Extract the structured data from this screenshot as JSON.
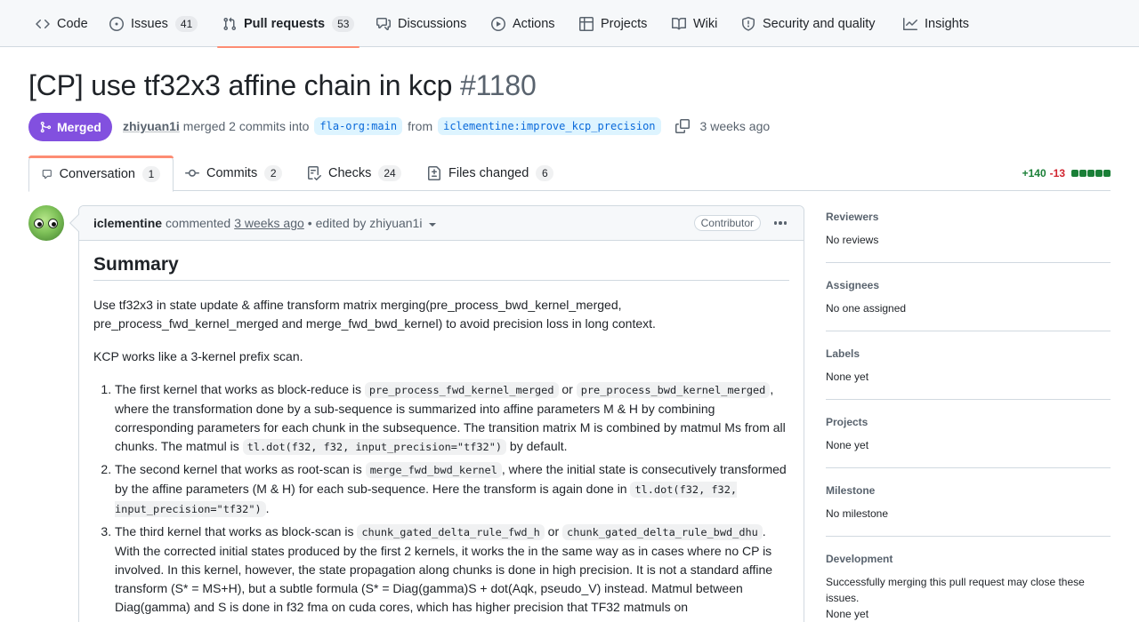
{
  "repo_nav": {
    "items": [
      {
        "label": "Code",
        "icon": "code-icon"
      },
      {
        "label": "Issues",
        "icon": "issue-icon",
        "count": "41"
      },
      {
        "label": "Pull requests",
        "icon": "pull-request-icon",
        "count": "53",
        "active": true
      },
      {
        "label": "Discussions",
        "icon": "comment-discussion-icon"
      },
      {
        "label": "Actions",
        "icon": "play-icon"
      },
      {
        "label": "Projects",
        "icon": "table-icon"
      },
      {
        "label": "Wiki",
        "icon": "book-icon"
      },
      {
        "label": "Security and quality",
        "icon": "shield-icon"
      },
      {
        "label": "Insights",
        "icon": "graph-icon"
      }
    ]
  },
  "pr": {
    "title": "[CP] use tf32x3 affine chain in kcp",
    "number": "#1180",
    "state": "Merged",
    "author": "zhiyuan1i",
    "merged_text": "merged 2 commits into",
    "base_branch": "fla-org:main",
    "from_text": "from",
    "head_branch": "iclementine:improve_kcp_precision",
    "time_ago": "3 weeks ago"
  },
  "tabs": [
    {
      "label": "Conversation",
      "count": "1",
      "icon": "comment-icon",
      "active": true
    },
    {
      "label": "Commits",
      "count": "2",
      "icon": "commit-icon"
    },
    {
      "label": "Checks",
      "count": "24",
      "icon": "checklist-icon"
    },
    {
      "label": "Files changed",
      "count": "6",
      "icon": "file-diff-icon"
    }
  ],
  "diffstat": {
    "additions": "+140",
    "deletions": "-13",
    "colors": [
      "#1a7f37",
      "#1a7f37",
      "#1a7f37",
      "#1a7f37",
      "#1a7f37",
      "#d1d9e0"
    ]
  },
  "comment": {
    "author": "iclementine",
    "action": "commented",
    "time": "3 weeks ago",
    "edited": "• edited by zhiyuan1i",
    "role": "Contributor",
    "heading": "Summary",
    "p1": "Use tf32x3 in state update & affine transform matrix merging(pre_process_bwd_kernel_merged, pre_process_fwd_kernel_merged and merge_fwd_bwd_kernel) to avoid precision loss in long context.",
    "p2": "KCP works like a 3-kernel prefix scan.",
    "li1": {
      "a": "The first kernel that works as block-reduce is ",
      "code1": "pre_process_fwd_kernel_merged",
      "b": " or ",
      "code2": "pre_process_bwd_kernel_merged",
      "c": ", where the transformation done by a sub-sequence is summarized into affine parameters M & H by combining corresponding parameters for each chunk in the subsequence. The transition matrix M is combined by matmul Ms from all chunks. The matmul is ",
      "code3": "tl.dot(f32, f32, input_precision=\"tf32\")",
      "d": " by default."
    },
    "li2": {
      "a": "The second kernel that works as root-scan is ",
      "code1": "merge_fwd_bwd_kernel",
      "b": ", where the initial state is consecutively transformed by the affine parameters (M & H) for each sub-sequence. Here the transform is again done in ",
      "code2": "tl.dot(f32, f32, input_precision=\"tf32\")",
      "c": "."
    },
    "li3": {
      "a": "The third kernel that works as block-scan is ",
      "code1": "chunk_gated_delta_rule_fwd_h",
      "b": " or ",
      "code2": "chunk_gated_delta_rule_bwd_dhu",
      "c": ". With the corrected initial states produced by the first 2 kernels, it works the in the same way as in cases where no CP is involved. In this kernel, however, the state propagation along chunks is done in high precision. It is not a standard affine transform (S* = MS+H), but a subtle formula (S* = Diag(gamma)S + dot(Aqk, pseudo_V) instead. Matmul between Diag(gamma) and S is done in f32 fma on cuda cores, which has higher precision that TF32 matmuls on"
    }
  },
  "sidebar": [
    {
      "title": "Reviewers",
      "value": "No reviews"
    },
    {
      "title": "Assignees",
      "value": "No one assigned"
    },
    {
      "title": "Labels",
      "value": "None yet"
    },
    {
      "title": "Projects",
      "value": "None yet"
    },
    {
      "title": "Milestone",
      "value": "No milestone"
    },
    {
      "title": "Development",
      "value": "Successfully merging this pull request may close these issues.",
      "value2": "None yet"
    }
  ]
}
